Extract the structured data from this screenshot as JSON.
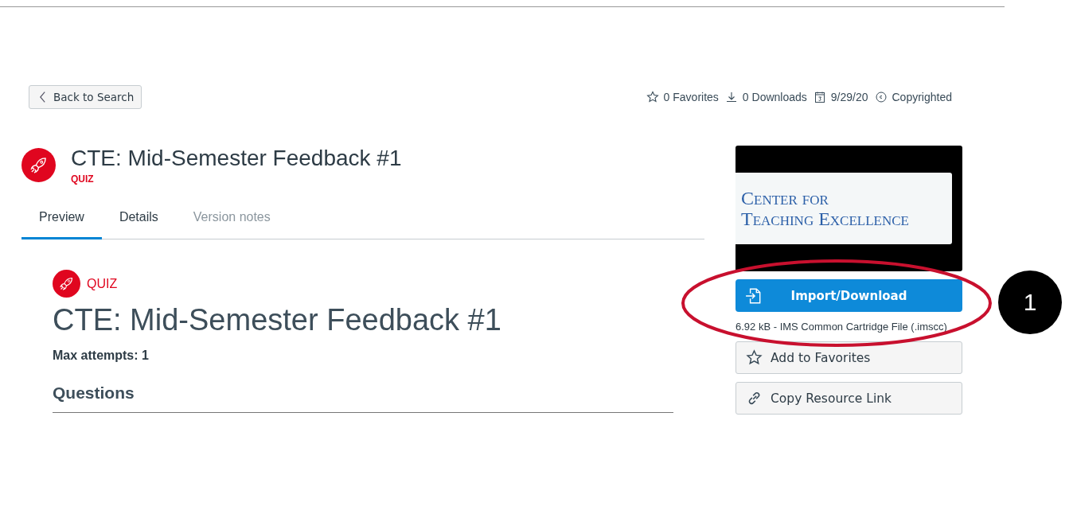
{
  "back_button": {
    "label": "Back to Search"
  },
  "meta": [
    {
      "kind": "star",
      "text": "0 Favorites"
    },
    {
      "kind": "download",
      "text": "0 Downloads"
    },
    {
      "kind": "calendar",
      "text": "9/29/20"
    },
    {
      "kind": "copyright",
      "text": "Copyrighted"
    }
  ],
  "header": {
    "title": "CTE: Mid-Semester Feedback #1",
    "type": "QUIZ"
  },
  "tabs": [
    {
      "label": "Preview",
      "selected": true
    },
    {
      "label": "Details",
      "selected": false
    },
    {
      "label": "Version notes",
      "selected": false,
      "disabled": true
    }
  ],
  "preview": {
    "type": "QUIZ",
    "title": "CTE: Mid-Semester Feedback #1",
    "max_attempts": "Max attempts: 1",
    "section": "Questions"
  },
  "sidebar": {
    "logo_lines": [
      "Center for",
      "Teaching Excellence"
    ],
    "import_button": "Import/Download",
    "file_info": "6.92 kB - IMS Common Cartridge File (.imscc)",
    "actions": [
      {
        "kind": "star",
        "label": "Add to Favorites"
      },
      {
        "kind": "link",
        "label": "Copy Resource Link"
      }
    ]
  },
  "callout": {
    "number": "1"
  }
}
